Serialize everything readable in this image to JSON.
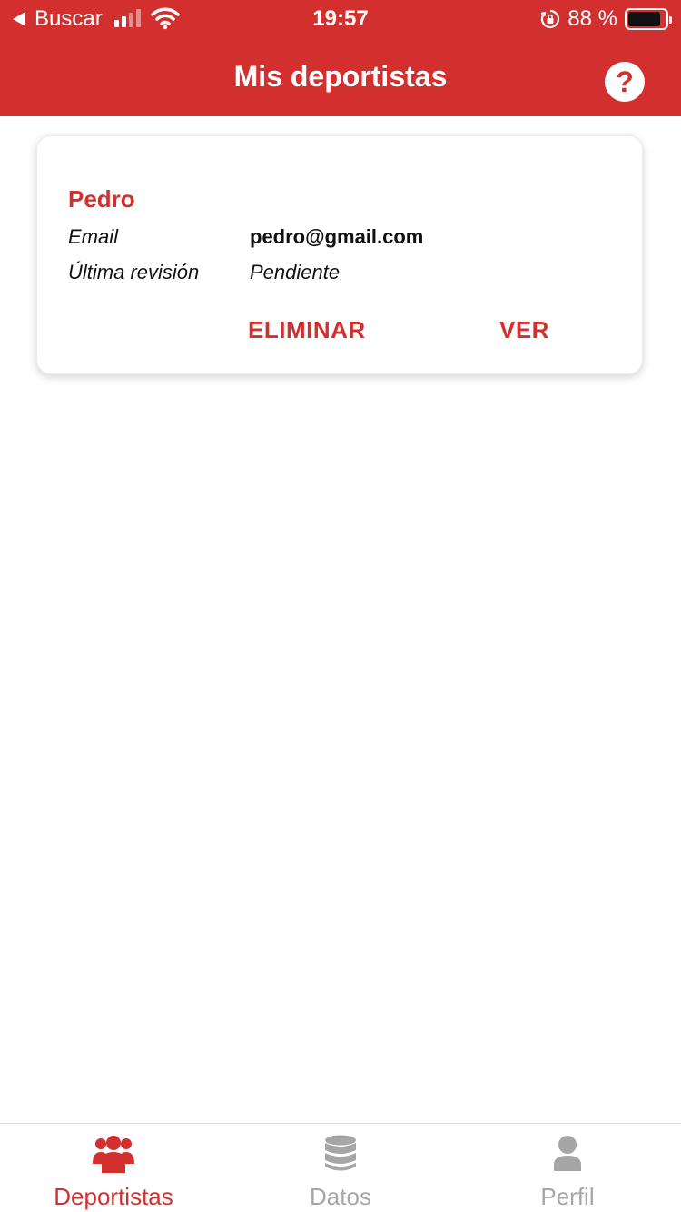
{
  "status_bar": {
    "back_label": "Buscar",
    "time": "19:57",
    "battery_text": "88 %"
  },
  "header": {
    "title": "Mis deportistas",
    "help_icon": "question-circle-icon",
    "help_glyph": "?"
  },
  "athletes": [
    {
      "name": "Pedro",
      "email_label": "Email",
      "email": "pedro@gmail.com",
      "review_label": "Última revisión",
      "review": "Pendiente",
      "delete_label": "ELIMINAR",
      "view_label": "VER"
    }
  ],
  "tabs": [
    {
      "label": "Deportistas",
      "icon": "users-icon",
      "active": true
    },
    {
      "label": "Datos",
      "icon": "database-icon",
      "active": false
    },
    {
      "label": "Perfil",
      "icon": "user-icon",
      "active": false
    }
  ],
  "colors": {
    "primary": "#d32f2f",
    "inactive": "#a6a6a6",
    "background": "#ffffff"
  }
}
